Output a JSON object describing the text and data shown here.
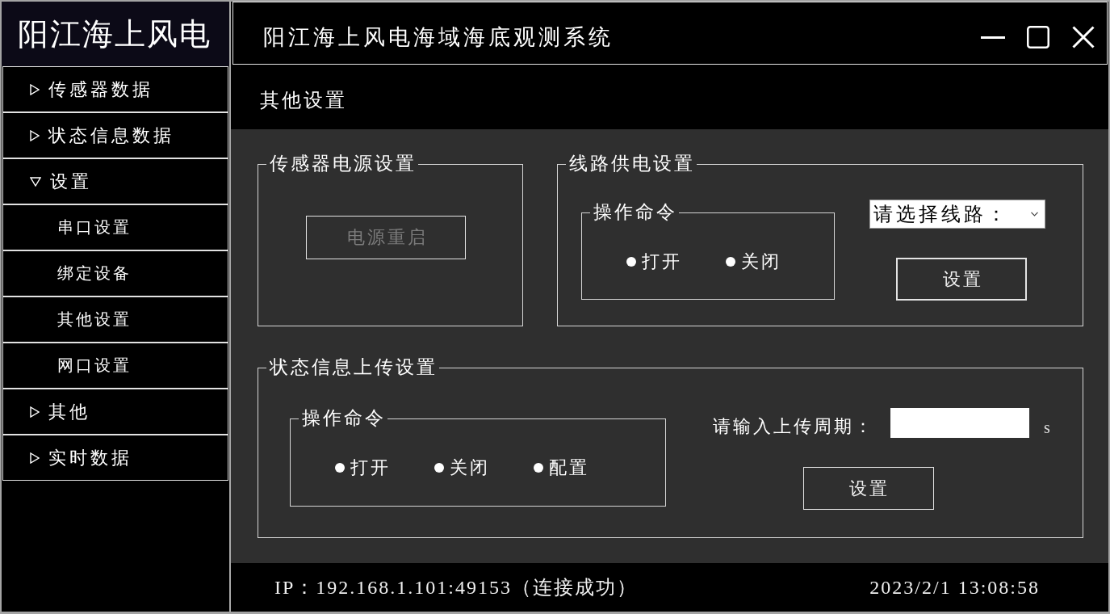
{
  "sidebar": {
    "title": "阳江海上风电",
    "items": [
      {
        "label": "传感器数据",
        "expanded": false
      },
      {
        "label": "状态信息数据",
        "expanded": false
      },
      {
        "label": "设置",
        "expanded": true,
        "children": [
          {
            "label": "串口设置"
          },
          {
            "label": "绑定设备"
          },
          {
            "label": "其他设置"
          },
          {
            "label": "网口设置"
          }
        ]
      },
      {
        "label": "其他",
        "expanded": false
      },
      {
        "label": "实时数据",
        "expanded": false
      }
    ]
  },
  "window": {
    "title": "阳江海上风电海域海底观测系统"
  },
  "page_title": "其他设置",
  "sensor_power": {
    "title": "传感器电源设置",
    "button": {
      "label": "电源重启",
      "disabled": true,
      "focused": false
    }
  },
  "line_power": {
    "title": "线路供电设置",
    "command_group": {
      "title": "操作命令",
      "options": [
        {
          "label": "打开",
          "selected": false
        },
        {
          "label": "关闭",
          "selected": false
        }
      ]
    },
    "line_select": {
      "value": "请选择线路："
    },
    "button": {
      "label": "设置",
      "disabled": false,
      "focused": true
    }
  },
  "status_upload": {
    "title": "状态信息上传设置",
    "command_group": {
      "title": "操作命令",
      "options": [
        {
          "label": "打开",
          "selected": false
        },
        {
          "label": "关闭",
          "selected": false
        },
        {
          "label": "配置",
          "selected": false
        }
      ]
    },
    "period_label": "请输入上传周期：",
    "unit": "s",
    "button": {
      "label": "设置",
      "disabled": false,
      "focused": false
    }
  },
  "status_bar": {
    "connection": "IP：192.168.1.101:49153（连接成功）",
    "datetime": "2023/2/1 13:08:58"
  }
}
